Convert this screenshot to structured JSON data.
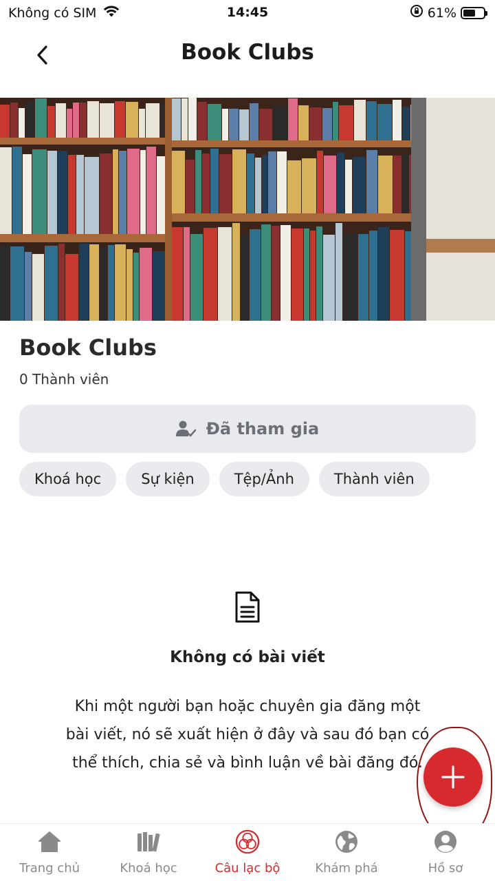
{
  "status_bar": {
    "carrier": "Không có SIM",
    "time": "14:45",
    "battery_percent": "61%",
    "battery_level": 0.61
  },
  "header": {
    "title": "Book Clubs",
    "back_icon": "chevron-left-icon"
  },
  "club": {
    "name": "Book Clubs",
    "members": "0 Thành viên",
    "joined_label": "Đã tham gia"
  },
  "chips": [
    {
      "label": "Khoá học"
    },
    {
      "label": "Sự kiện"
    },
    {
      "label": "Tệp/Ảnh"
    },
    {
      "label": "Thành viên"
    }
  ],
  "empty_state": {
    "icon": "document-icon",
    "title": "Không có bài viết",
    "line1": "Khi một người bạn hoặc chuyên gia đăng một",
    "line2": "bài viết, nó sẽ xuất hiện ở đây và sau đó bạn có",
    "line3": "thể thích, chia sẻ và bình luận về bài đăng đó."
  },
  "fab": {
    "icon": "plus-icon"
  },
  "bottom_nav": [
    {
      "label": "Trang chủ",
      "icon": "home-icon"
    },
    {
      "label": "Khoá học",
      "icon": "books-icon"
    },
    {
      "label": "Câu lạc bộ",
      "icon": "club-icon",
      "active": true
    },
    {
      "label": "Khám phá",
      "icon": "globe-icon"
    },
    {
      "label": "Hồ sơ",
      "icon": "profile-icon"
    }
  ],
  "colors": {
    "accent": "#d62a2f",
    "chip_bg": "#e9eaed",
    "nav_inactive": "#8a8a8a"
  }
}
